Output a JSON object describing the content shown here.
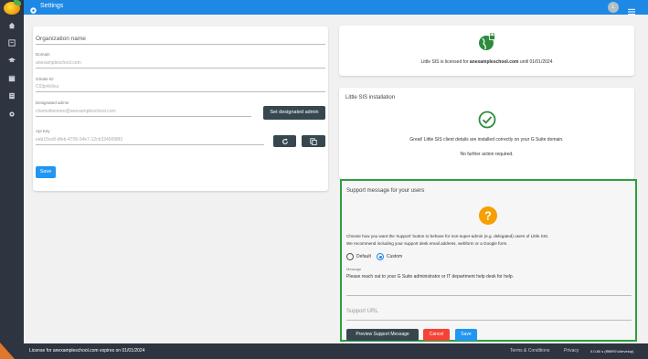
{
  "app": {
    "title": "Settings",
    "avatar_letter": "L"
  },
  "rail": {
    "items": [
      "home-icon",
      "list-icon",
      "graduation-cap-icon",
      "box-icon",
      "document-icon",
      "gear-icon"
    ]
  },
  "org": {
    "title": "Organization name",
    "domain_label": "Domain",
    "domain_value": "anexampleschool.com",
    "gsuite_label": "GSuite ID",
    "gsuite_value": "C03p4x9xu",
    "admin_label": "Designated admin",
    "admin_value": "chemolitemore@anexampleschool.com",
    "set_admin_button": "Set designated admin",
    "api_label": "Api Key",
    "api_value": "eeb15ce8-dfeb-4705-94e7-12cb3240098f3",
    "save_button": "Save"
  },
  "license": {
    "prefix": "Little SIS is licensed for ",
    "domain": "anexampleschool.com",
    "suffix": " until 01/01/2024"
  },
  "installation": {
    "title": "Little SIS installation",
    "message": "Great! Little SIS client details are installed correctly on your G Suite domain.",
    "note": "No further action required."
  },
  "support": {
    "title": "Support message for your users",
    "description_line1": "Choose how you want the 'support' button to behave for non-super-admin (e.g. delegated) users of Little SIS.",
    "description_line2": "We recommend including your support desk email address, webform or a Google form.",
    "option_default": "Default",
    "option_custom": "Custom",
    "selected": "Custom",
    "message_label": "Message",
    "message_value": "Please reach out to your G Suite administrator or IT department help desk for help.",
    "url_placeholder": "Support URL",
    "preview_button": "Preview Support Message",
    "cancel_button": "Cancel",
    "save_button": "Save"
  },
  "footer": {
    "license_text": "License for anexampleschool.com expires on 01/01/2024",
    "terms": "Terms & Conditions",
    "privacy": "Privacy",
    "version": "0.0.80 s (f5f5f97c/develop)"
  },
  "colors": {
    "accent": "#1e88e5",
    "success": "#43a047",
    "warning": "#f59f00",
    "danger": "#f44336",
    "highlight_border": "#2e9e3f"
  }
}
